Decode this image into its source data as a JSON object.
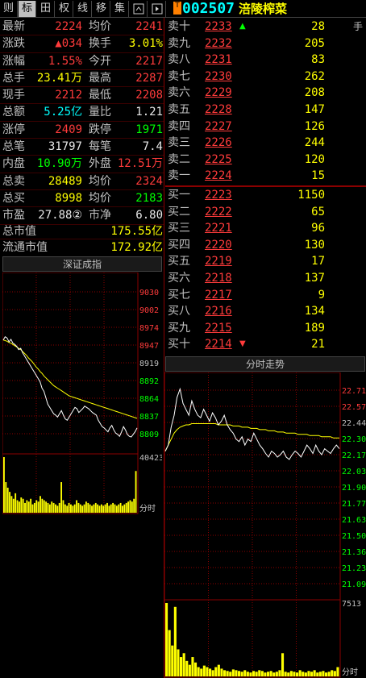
{
  "tabs": [
    "则",
    "标",
    "田",
    "权",
    "线",
    "移",
    "集"
  ],
  "active_tab": 1,
  "stock": {
    "code": "002507",
    "name": "涪陵榨菜",
    "badge": "T"
  },
  "quote_rows": [
    {
      "l1": "最新",
      "v1": "2224",
      "c1": "red",
      "l2": "均价",
      "v2": "2241",
      "c2": "red"
    },
    {
      "l1": "涨跌",
      "v1": "▲034",
      "c1": "red",
      "l2": "换手",
      "v2": "3.01%",
      "c2": "yellow"
    },
    {
      "l1": "涨幅",
      "v1": "1.55%",
      "c1": "red",
      "l2": "今开",
      "v2": "2217",
      "c2": "red"
    },
    {
      "l1": "总手",
      "v1": "23.41万",
      "c1": "yellow",
      "l2": "最高",
      "v2": "2287",
      "c2": "red"
    },
    {
      "l1": "现手",
      "v1": "2212",
      "c1": "red",
      "l2": "最低",
      "v2": "2208",
      "c2": "red"
    },
    {
      "l1": "总额",
      "v1": "5.25亿",
      "c1": "cyan",
      "l2": "量比",
      "v2": "1.21",
      "c2": "white"
    },
    {
      "l1": "涨停",
      "v1": "2409",
      "c1": "red",
      "l2": "跌停",
      "v2": "1971",
      "c2": "green"
    },
    {
      "l1": "总笔",
      "v1": "31797",
      "c1": "white",
      "l2": "每笔",
      "v2": "7.4",
      "c2": "white"
    },
    {
      "l1": "内盘",
      "v1": "10.90万",
      "c1": "green",
      "l2": "外盘",
      "v2": "12.51万",
      "c2": "red"
    },
    {
      "l1": "总卖",
      "v1": "28489",
      "c1": "yellow",
      "l2": "均价",
      "v2": "2324",
      "c2": "red"
    },
    {
      "l1": "总买",
      "v1": "8998",
      "c1": "yellow",
      "l2": "均价",
      "v2": "2183",
      "c2": "green"
    },
    {
      "l1": "市盈",
      "v1": "27.88②",
      "c1": "white",
      "l2": "市净",
      "v2": "6.80",
      "c2": "white"
    }
  ],
  "market_cap": {
    "total_label": "总市值",
    "total_value": "175.55亿",
    "float_label": "流通市值",
    "float_value": "172.92亿"
  },
  "hand_label": "手",
  "asks": [
    {
      "label": "卖十",
      "price": "2233",
      "vol": "28"
    },
    {
      "label": "卖九",
      "price": "2232",
      "vol": "205"
    },
    {
      "label": "卖八",
      "price": "2231",
      "vol": "83"
    },
    {
      "label": "卖七",
      "price": "2230",
      "vol": "262"
    },
    {
      "label": "卖六",
      "price": "2229",
      "vol": "208"
    },
    {
      "label": "卖五",
      "price": "2228",
      "vol": "147"
    },
    {
      "label": "卖四",
      "price": "2227",
      "vol": "126"
    },
    {
      "label": "卖三",
      "price": "2226",
      "vol": "244"
    },
    {
      "label": "卖二",
      "price": "2225",
      "vol": "120"
    },
    {
      "label": "卖一",
      "price": "2224",
      "vol": "15"
    }
  ],
  "bids": [
    {
      "label": "买一",
      "price": "2223",
      "vol": "1150"
    },
    {
      "label": "买二",
      "price": "2222",
      "vol": "65"
    },
    {
      "label": "买三",
      "price": "2221",
      "vol": "96"
    },
    {
      "label": "买四",
      "price": "2220",
      "vol": "130"
    },
    {
      "label": "买五",
      "price": "2219",
      "vol": "17"
    },
    {
      "label": "买六",
      "price": "2218",
      "vol": "137"
    },
    {
      "label": "买七",
      "price": "2217",
      "vol": "9"
    },
    {
      "label": "买八",
      "price": "2216",
      "vol": "134"
    },
    {
      "label": "买九",
      "price": "2215",
      "vol": "189"
    },
    {
      "label": "买十",
      "price": "2214",
      "vol": "21"
    }
  ],
  "colors": {
    "up": "#ff3b3b",
    "down": "#00ff00",
    "price_line": "#ffffff",
    "avg_line": "#ffff00",
    "volume": "#ffff00",
    "grid": "#8b0000"
  },
  "index_chart": {
    "title": "深证成指",
    "yticks": [
      "9030",
      "9002",
      "8974",
      "8947",
      "8919",
      "8892",
      "8864",
      "8837",
      "8809"
    ],
    "vol_tick": "40423",
    "xlabel": "分时",
    "price": [
      8955,
      8960,
      8958,
      8952,
      8956,
      8950,
      8948,
      8945,
      8940,
      8942,
      8935,
      8930,
      8925,
      8920,
      8915,
      8910,
      8905,
      8900,
      8895,
      8890,
      8880,
      8875,
      8865,
      8855,
      8850,
      8845,
      8840,
      8838,
      8835,
      8840,
      8845,
      8838,
      8832,
      8830,
      8835,
      8840,
      8845,
      8850,
      8848,
      8842,
      8845,
      8848,
      8852,
      8850,
      8848,
      8845,
      8842,
      8840,
      8838,
      8830,
      8825,
      8820,
      8818,
      8815,
      8812,
      8818,
      8822,
      8815,
      8810,
      8808,
      8805,
      8812,
      8820,
      8815,
      8808,
      8805,
      8804,
      8808,
      8812,
      8818
    ],
    "avg": [
      8955,
      8954,
      8953,
      8951,
      8950,
      8948,
      8946,
      8944,
      8942,
      8940,
      8937,
      8934,
      8931,
      8927,
      8924,
      8921,
      8917,
      8913,
      8910,
      8906,
      8903,
      8899,
      8896,
      8893,
      8890,
      8887,
      8884,
      8882,
      8880,
      8878,
      8876,
      8874,
      8872,
      8870,
      8868,
      8867,
      8866,
      8865,
      8864,
      8863,
      8862,
      8861,
      8860,
      8859,
      8858,
      8857,
      8856,
      8855,
      8854,
      8853,
      8852,
      8851,
      8850,
      8849,
      8848,
      8847,
      8846,
      8845,
      8844,
      8843,
      8842,
      8841,
      8840,
      8839,
      8838,
      8837,
      8836,
      8835,
      8834,
      8833
    ],
    "ylim": [
      8809,
      9030
    ],
    "volume": [
      40,
      22,
      18,
      15,
      12,
      10,
      14,
      9,
      8,
      11,
      10,
      7,
      9,
      8,
      10,
      6,
      7,
      9,
      8,
      12,
      10,
      9,
      8,
      7,
      6,
      8,
      7,
      6,
      5,
      7,
      22,
      9,
      6,
      5,
      7,
      6,
      5,
      6,
      9,
      7,
      6,
      5,
      6,
      8,
      7,
      6,
      5,
      6,
      7,
      6,
      5,
      6,
      5,
      6,
      7,
      5,
      6,
      7,
      6,
      5,
      6,
      7,
      5,
      6,
      7,
      8,
      9,
      8,
      10,
      30
    ]
  },
  "stock_chart": {
    "title": "分时走势",
    "yticks_right": [
      "22.71",
      "22.57",
      "22.44",
      "22.30",
      "22.17",
      "22.03",
      "21.90",
      "21.77",
      "21.63",
      "21.50",
      "21.36",
      "21.23",
      "21.09"
    ],
    "vol_tick": "7513",
    "xlabel": "分时",
    "price": [
      22.2,
      22.25,
      22.4,
      22.5,
      22.65,
      22.72,
      22.6,
      22.55,
      22.5,
      22.62,
      22.55,
      22.5,
      22.48,
      22.55,
      22.5,
      22.45,
      22.52,
      22.48,
      22.42,
      22.45,
      22.5,
      22.42,
      22.38,
      22.35,
      22.3,
      22.28,
      22.32,
      22.25,
      22.3,
      22.28,
      22.35,
      22.3,
      22.25,
      22.22,
      22.18,
      22.15,
      22.2,
      22.18,
      22.15,
      22.17,
      22.2,
      22.15,
      22.13,
      22.17,
      22.2,
      22.18,
      22.15,
      22.2,
      22.25,
      22.22,
      22.18,
      22.25,
      22.2,
      22.17,
      22.22,
      22.2,
      22.18,
      22.22,
      22.25,
      22.22
    ],
    "avg": [
      22.2,
      22.25,
      22.3,
      22.35,
      22.38,
      22.4,
      22.41,
      22.42,
      22.42,
      22.43,
      22.43,
      22.43,
      22.43,
      22.43,
      22.43,
      22.43,
      22.43,
      22.43,
      22.42,
      22.42,
      22.42,
      22.42,
      22.42,
      22.41,
      22.41,
      22.41,
      22.4,
      22.4,
      22.4,
      22.39,
      22.39,
      22.39,
      22.38,
      22.38,
      22.38,
      22.37,
      22.37,
      22.37,
      22.36,
      22.36,
      22.36,
      22.35,
      22.35,
      22.35,
      22.35,
      22.34,
      22.34,
      22.34,
      22.34,
      22.33,
      22.33,
      22.33,
      22.33,
      22.32,
      22.32,
      22.32,
      22.32,
      22.31,
      22.31,
      22.31
    ],
    "ylim": [
      21.09,
      22.71
    ],
    "volume": [
      95,
      60,
      40,
      90,
      35,
      25,
      30,
      20,
      15,
      25,
      18,
      12,
      10,
      14,
      12,
      10,
      8,
      12,
      15,
      10,
      8,
      7,
      6,
      9,
      8,
      7,
      6,
      8,
      6,
      5,
      7,
      6,
      8,
      7,
      5,
      6,
      7,
      5,
      6,
      8,
      30,
      6,
      5,
      7,
      6,
      5,
      8,
      6,
      5,
      7,
      6,
      8,
      5,
      6,
      7,
      5,
      6,
      8,
      7,
      12
    ]
  }
}
